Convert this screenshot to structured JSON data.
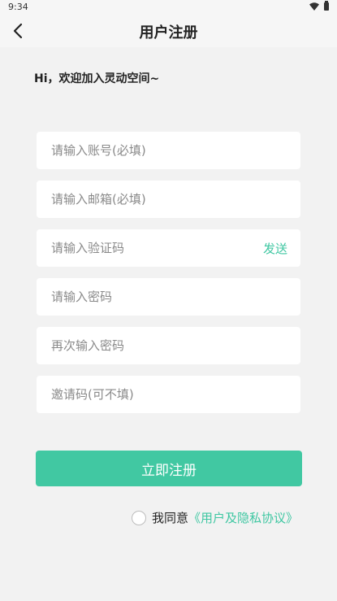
{
  "status_bar": {
    "time": "9:34"
  },
  "header": {
    "title": "用户注册"
  },
  "welcome": "Hi，欢迎加入灵动空间~",
  "form": {
    "account_placeholder": "请输入账号(必填)",
    "email_placeholder": "请输入邮箱(必填)",
    "code_placeholder": "请输入验证码",
    "send_label": "发送",
    "password_placeholder": "请输入密码",
    "confirm_password_placeholder": "再次输入密码",
    "invite_placeholder": "邀请码(可不填)",
    "submit_label": "立即注册"
  },
  "agreement": {
    "text": "我同意",
    "link": "《用户及隐私协议》"
  },
  "colors": {
    "accent": "#41c8a2",
    "background": "#f2f2f2"
  }
}
